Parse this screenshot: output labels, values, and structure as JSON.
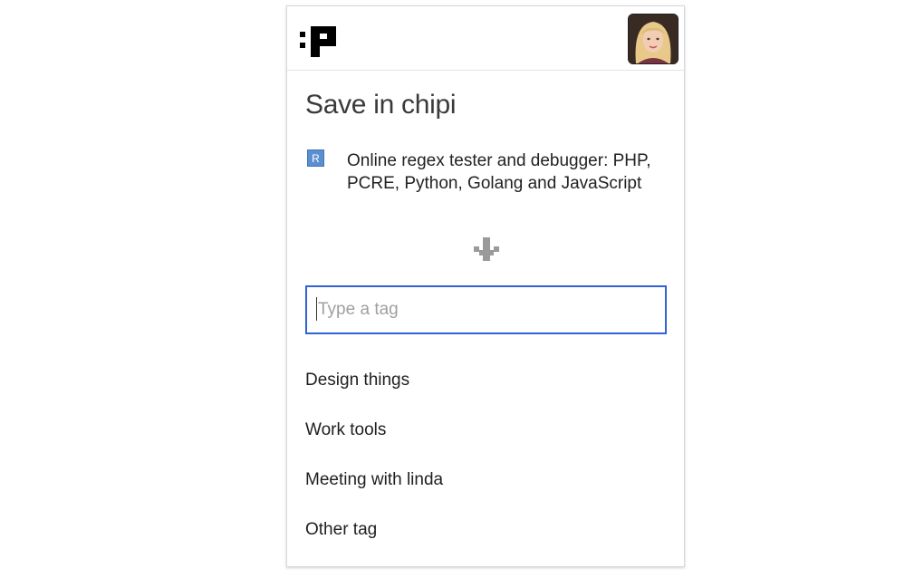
{
  "header": {
    "logo_icon": "chipi-logo-icon",
    "avatar_icon": "user-avatar"
  },
  "title": "Save in chipi",
  "page": {
    "favicon_letter": "R",
    "title": "Online regex tester and debugger: PHP, PCRE, Python, Golang and JavaScript"
  },
  "arrow_icon": "arrow-down-icon",
  "tag_input": {
    "placeholder": "Type a tag",
    "value": ""
  },
  "tags": [
    {
      "label": "Design things"
    },
    {
      "label": "Work tools"
    },
    {
      "label": "Meeting with linda"
    },
    {
      "label": "Other tag"
    }
  ],
  "colors": {
    "accent": "#2f63d6",
    "favicon": "#5b8fd0",
    "text": "#1f1f1f",
    "arrow": "#9a9a9a"
  }
}
